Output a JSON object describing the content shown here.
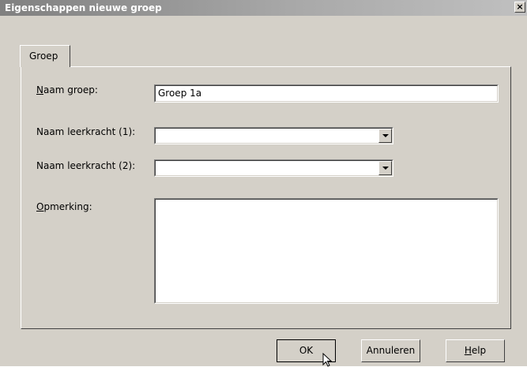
{
  "window": {
    "title": "Eigenschappen nieuwe groep",
    "close_glyph": "×"
  },
  "tabs": [
    {
      "label": "Groep"
    }
  ],
  "form": {
    "naam_groep": {
      "label_first": "N",
      "label_rest": "aam groep:",
      "value": "Groep 1a"
    },
    "leerkracht1": {
      "label": "Naam leerkracht (1):",
      "value": ""
    },
    "leerkracht2": {
      "label": "Naam leerkracht (2):",
      "value": ""
    },
    "opmerking": {
      "label_first": "O",
      "label_rest": "pmerking:",
      "value": ""
    }
  },
  "buttons": {
    "ok": "OK",
    "cancel": "Annuleren",
    "help_first": "H",
    "help_rest": "elp"
  },
  "colors": {
    "face": "#d4d0c8",
    "title_start": "#808080",
    "title_end": "#c0c0c0"
  }
}
